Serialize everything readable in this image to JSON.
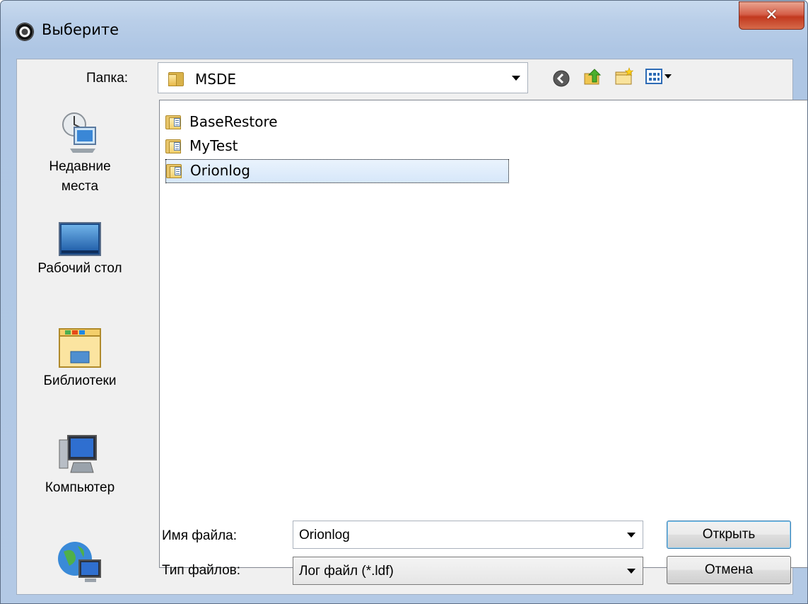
{
  "window": {
    "title": "Выберите"
  },
  "toolbar": {
    "folder_label": "Папка:",
    "current_folder": "MSDE",
    "icons": [
      "back-icon",
      "up-folder-icon",
      "new-folder-icon",
      "view-menu-icon"
    ]
  },
  "sidebar": {
    "items": [
      {
        "label_line1": "Недавние",
        "label_line2": "места",
        "icon": "recent-places-icon"
      },
      {
        "label": "Рабочий стол",
        "icon": "desktop-icon"
      },
      {
        "label": "Библиотеки",
        "icon": "libraries-icon"
      },
      {
        "label": "Компьютер",
        "icon": "computer-icon"
      },
      {
        "label": "",
        "icon": "network-icon"
      }
    ]
  },
  "files": [
    {
      "name": "BaseRestore",
      "icon": "folder-icon"
    },
    {
      "name": "MyTest",
      "icon": "folder-icon"
    },
    {
      "name": "Orionlog",
      "icon": "folder-icon",
      "selected": true
    }
  ],
  "footer": {
    "filename_label": "Имя файла:",
    "filename_value": "Orionlog",
    "filetype_label": "Тип файлов:",
    "filetype_value": "Лог файл (*.ldf)",
    "open_button": "Открыть",
    "cancel_button": "Отмена"
  },
  "colors": {
    "accent": "#3c7fb1",
    "close": "#c2391f",
    "frame": "#b9cee8"
  }
}
